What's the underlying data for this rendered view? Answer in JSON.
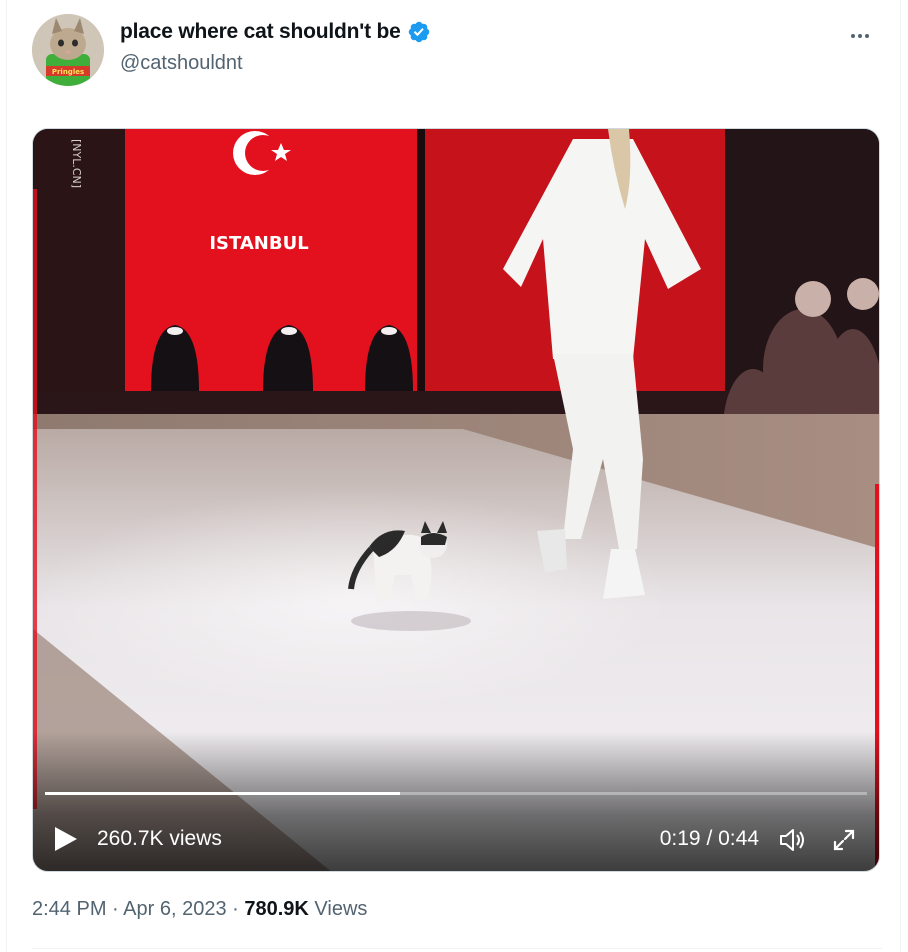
{
  "tweet": {
    "author": {
      "display_name": "place where cat shouldn't be",
      "handle": "@catshouldnt",
      "verified": true,
      "avatar_icon": "cat-in-pringles-can-avatar",
      "avatar_text": "Pringles"
    },
    "more_icon": "more-horizontal-icon",
    "video": {
      "overlay_text": {
        "screen_label": "ISTANBUL",
        "watermark": "[NYL.CN]"
      },
      "views_label": "260.7K views",
      "current_time": "0:19",
      "time_separator": " / ",
      "duration": "0:44",
      "progress": 0.432,
      "play_icon": "play-icon",
      "volume_icon": "volume-icon",
      "fullscreen_icon": "fullscreen-expand-icon"
    },
    "meta": {
      "time": "2:44 PM",
      "separator": " · ",
      "date": "Apr 6, 2023",
      "views_count": "780.9K",
      "views_word": "Views"
    }
  },
  "colors": {
    "text_primary": "#0f1419",
    "text_secondary": "#536471",
    "verified_blue": "#1d9bf0",
    "screen_red": "#e3101e"
  }
}
